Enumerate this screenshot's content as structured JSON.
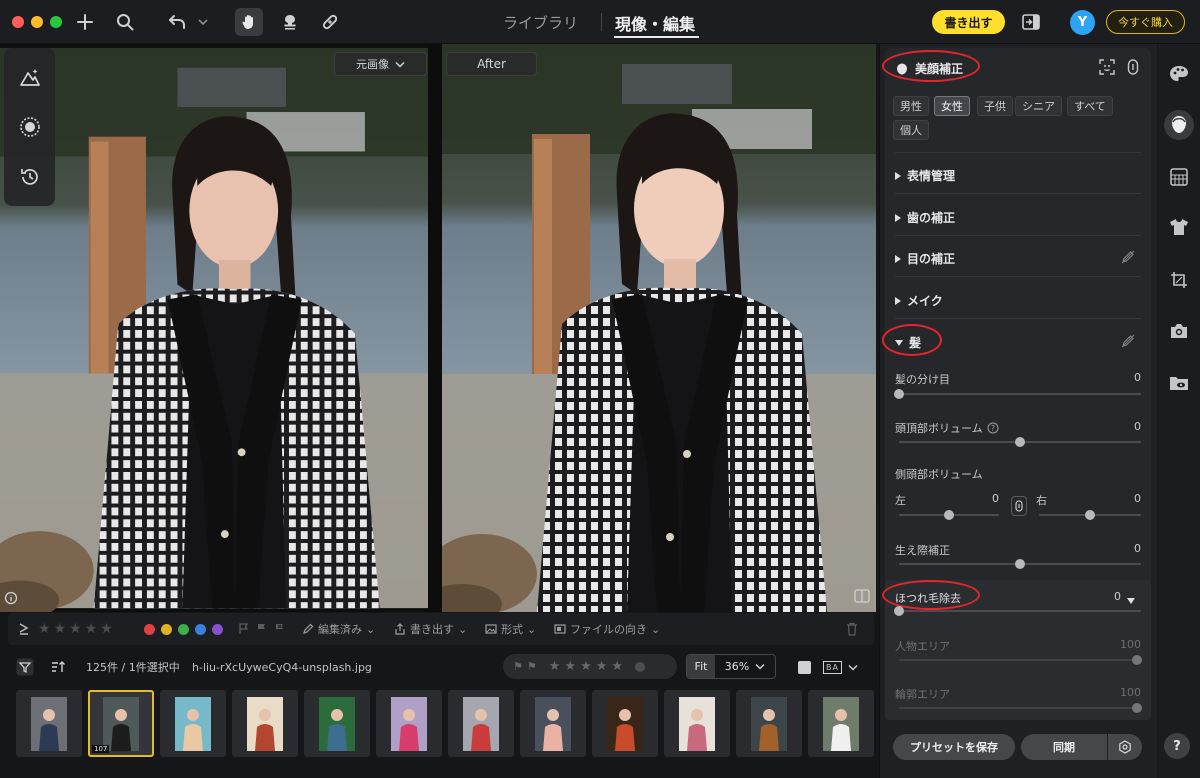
{
  "topbar": {
    "tab_library": "ライブラリ",
    "tab_develop": "現像・編集",
    "export_label": "書き出す",
    "avatar_letter": "Y",
    "buy_label": "今すぐ購入"
  },
  "canvas": {
    "before_label": "元画像",
    "after_label": "After"
  },
  "info_bar": {
    "count_text": "125件 / 1件選択中",
    "filename": "h-liu-rXcUyweCyQ4-unsplash.jpg",
    "zoom_fit": "Fit",
    "zoom_value": "36%",
    "ba_label": "BA"
  },
  "rating_bar": {
    "edited_label": "編集済み",
    "export_label": "書き出す",
    "format_label": "形式",
    "orientation_label": "ファイルの向き",
    "color_labels": [
      "#e04040",
      "#e0b020",
      "#3aae4a",
      "#3a82e0",
      "#8a50d0"
    ]
  },
  "filmstrip": {
    "selected_badge": "107",
    "thumbs": [
      {
        "bg": "#6c6f74",
        "fg": "#2c3a55"
      },
      {
        "bg": "#4e5a5a",
        "fg": "#1c1c1c"
      },
      {
        "bg": "#76b9c8",
        "fg": "#e9c9a4"
      },
      {
        "bg": "#e9dcc6",
        "fg": "#b2462f"
      },
      {
        "bg": "#2c6c3c",
        "fg": "#3c6f8f"
      },
      {
        "bg": "#b0a0c8",
        "fg": "#d83c6c"
      },
      {
        "bg": "#a5a6b0",
        "fg": "#c83c3c"
      },
      {
        "bg": "#4a4f5c",
        "fg": "#e9b2a4"
      },
      {
        "bg": "#3a2618",
        "fg": "#c84c2c"
      },
      {
        "bg": "#e7e1da",
        "fg": "#c8697c"
      },
      {
        "bg": "#3c4648",
        "fg": "#a1612b"
      },
      {
        "bg": "#6f7c6c",
        "fg": "#f0f0f0"
      }
    ]
  },
  "panel": {
    "beauty_title": "美顔補正",
    "chips": [
      "男性",
      "女性",
      "子供",
      "シニア",
      "すべて",
      "個人"
    ],
    "active_chip": "女性",
    "sections": {
      "expression": "表情管理",
      "teeth": "歯の補正",
      "eyes": "目の補正",
      "makeup": "メイク",
      "hair": "髪"
    },
    "hair_parting": {
      "label": "髪の分け目",
      "value": "0",
      "level": 0
    },
    "crown_volume": {
      "label": "頭頂部ボリューム",
      "value": "0",
      "level": 0.5
    },
    "side_volume": {
      "label": "側頭部ボリューム",
      "left_label": "左",
      "left_value": "0",
      "right_label": "右",
      "right_value": "0",
      "left_level": 0.5,
      "right_level": 0.5
    },
    "hairline": {
      "label": "生え際補正",
      "value": "0",
      "level": 0.5
    },
    "flyaway": {
      "label": "ほつれ毛除去",
      "value": "0",
      "level": 0
    },
    "person_area": {
      "label": "人物エリア",
      "value": "100",
      "level": 1
    },
    "contour_area": {
      "label": "輪郭エリア",
      "value": "100",
      "level": 1
    },
    "save_preset": "プリセットを保存",
    "sync": "同期"
  },
  "help": "?"
}
